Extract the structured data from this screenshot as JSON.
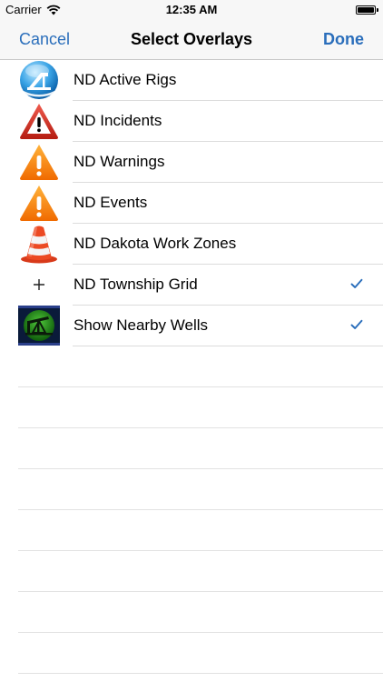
{
  "status_bar": {
    "carrier": "Carrier",
    "time": "12:35 AM"
  },
  "nav": {
    "cancel_label": "Cancel",
    "title": "Select Overlays",
    "done_label": "Done",
    "accent_color": "#2a6ebb"
  },
  "overlays": [
    {
      "label": "ND Active Rigs",
      "icon": "oil-rig-icon",
      "checked": false
    },
    {
      "label": "ND Incidents",
      "icon": "red-warning-icon",
      "checked": false
    },
    {
      "label": "ND Warnings",
      "icon": "orange-warning-icon",
      "checked": false
    },
    {
      "label": "ND Events",
      "icon": "orange-warning-icon",
      "checked": false
    },
    {
      "label": "ND Dakota Work Zones",
      "icon": "traffic-cone-icon",
      "checked": false
    },
    {
      "label": "ND Township Grid",
      "icon": "plus-icon",
      "checked": true
    },
    {
      "label": "Show Nearby Wells",
      "icon": "pumpjack-icon",
      "checked": true
    }
  ]
}
